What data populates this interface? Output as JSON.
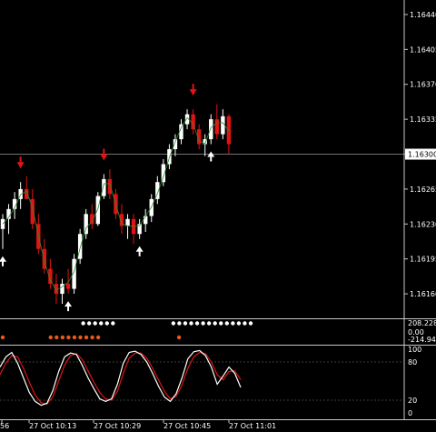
{
  "chart_data": {
    "type": "candlestick",
    "instrument_timeframe": "",
    "price_axis": {
      "ticks": [
        "1.16440",
        "1.16405",
        "1.16370",
        "1.16335",
        "1.16300",
        "1.16265",
        "1.16230",
        "1.16195",
        "1.16160"
      ],
      "current_price_label": "1.16300",
      "range": [
        1.1614,
        1.1645
      ]
    },
    "time_axis": {
      "labels": [
        "56",
        "27 Oct 10:13",
        "27 Oct 10:29",
        "27 Oct 10:45",
        "27 Oct 11:01"
      ]
    },
    "candles": [
      {
        "o": 1.16225,
        "h": 1.1624,
        "l": 1.16205,
        "c": 1.16235,
        "dir": "up"
      },
      {
        "o": 1.16235,
        "h": 1.1625,
        "l": 1.1622,
        "c": 1.16245,
        "dir": "up"
      },
      {
        "o": 1.16245,
        "h": 1.16262,
        "l": 1.16235,
        "c": 1.16255,
        "dir": "up"
      },
      {
        "o": 1.16255,
        "h": 1.16272,
        "l": 1.16245,
        "c": 1.16265,
        "dir": "up"
      },
      {
        "o": 1.16265,
        "h": 1.16278,
        "l": 1.16255,
        "c": 1.16255,
        "dir": "down"
      },
      {
        "o": 1.16255,
        "h": 1.16265,
        "l": 1.16225,
        "c": 1.1623,
        "dir": "down"
      },
      {
        "o": 1.1623,
        "h": 1.1624,
        "l": 1.162,
        "c": 1.16205,
        "dir": "down"
      },
      {
        "o": 1.16205,
        "h": 1.16215,
        "l": 1.1618,
        "c": 1.16185,
        "dir": "down"
      },
      {
        "o": 1.16185,
        "h": 1.16195,
        "l": 1.16165,
        "c": 1.1617,
        "dir": "down"
      },
      {
        "o": 1.1617,
        "h": 1.1618,
        "l": 1.1615,
        "c": 1.1616,
        "dir": "down"
      },
      {
        "o": 1.1616,
        "h": 1.16175,
        "l": 1.1615,
        "c": 1.1617,
        "dir": "up"
      },
      {
        "o": 1.1617,
        "h": 1.16185,
        "l": 1.1616,
        "c": 1.16165,
        "dir": "down"
      },
      {
        "o": 1.16165,
        "h": 1.162,
        "l": 1.1616,
        "c": 1.16195,
        "dir": "up"
      },
      {
        "o": 1.16195,
        "h": 1.16225,
        "l": 1.1619,
        "c": 1.1622,
        "dir": "up"
      },
      {
        "o": 1.1622,
        "h": 1.16245,
        "l": 1.16215,
        "c": 1.1624,
        "dir": "up"
      },
      {
        "o": 1.1624,
        "h": 1.1625,
        "l": 1.16225,
        "c": 1.1623,
        "dir": "down"
      },
      {
        "o": 1.1623,
        "h": 1.16262,
        "l": 1.16228,
        "c": 1.16258,
        "dir": "up"
      },
      {
        "o": 1.16258,
        "h": 1.1628,
        "l": 1.16255,
        "c": 1.16275,
        "dir": "up"
      },
      {
        "o": 1.16275,
        "h": 1.16285,
        "l": 1.16255,
        "c": 1.1626,
        "dir": "down"
      },
      {
        "o": 1.1626,
        "h": 1.16265,
        "l": 1.16235,
        "c": 1.1624,
        "dir": "down"
      },
      {
        "o": 1.1624,
        "h": 1.1625,
        "l": 1.1622,
        "c": 1.16228,
        "dir": "down"
      },
      {
        "o": 1.16228,
        "h": 1.1624,
        "l": 1.16215,
        "c": 1.16235,
        "dir": "up"
      },
      {
        "o": 1.16235,
        "h": 1.1624,
        "l": 1.1621,
        "c": 1.1622,
        "dir": "down"
      },
      {
        "o": 1.1622,
        "h": 1.16235,
        "l": 1.16215,
        "c": 1.1623,
        "dir": "up"
      },
      {
        "o": 1.1623,
        "h": 1.16245,
        "l": 1.16222,
        "c": 1.16238,
        "dir": "up"
      },
      {
        "o": 1.16238,
        "h": 1.1626,
        "l": 1.16232,
        "c": 1.16255,
        "dir": "up"
      },
      {
        "o": 1.16255,
        "h": 1.16278,
        "l": 1.1625,
        "c": 1.16272,
        "dir": "up"
      },
      {
        "o": 1.16272,
        "h": 1.16295,
        "l": 1.16268,
        "c": 1.1629,
        "dir": "up"
      },
      {
        "o": 1.1629,
        "h": 1.1631,
        "l": 1.16285,
        "c": 1.16305,
        "dir": "up"
      },
      {
        "o": 1.16305,
        "h": 1.1632,
        "l": 1.16298,
        "c": 1.16315,
        "dir": "up"
      },
      {
        "o": 1.16315,
        "h": 1.16335,
        "l": 1.1631,
        "c": 1.1633,
        "dir": "up"
      },
      {
        "o": 1.1633,
        "h": 1.16345,
        "l": 1.16325,
        "c": 1.1634,
        "dir": "up"
      },
      {
        "o": 1.1634,
        "h": 1.16345,
        "l": 1.1632,
        "c": 1.16325,
        "dir": "down"
      },
      {
        "o": 1.16325,
        "h": 1.1633,
        "l": 1.16305,
        "c": 1.1631,
        "dir": "down"
      },
      {
        "o": 1.1631,
        "h": 1.1632,
        "l": 1.16298,
        "c": 1.16315,
        "dir": "up"
      },
      {
        "o": 1.16315,
        "h": 1.1634,
        "l": 1.1631,
        "c": 1.16335,
        "dir": "up"
      },
      {
        "o": 1.16335,
        "h": 1.1635,
        "l": 1.16315,
        "c": 1.1632,
        "dir": "down"
      },
      {
        "o": 1.1632,
        "h": 1.16345,
        "l": 1.16315,
        "c": 1.16338,
        "dir": "up"
      },
      {
        "o": 1.16338,
        "h": 1.1634,
        "l": 1.163,
        "c": 1.1631,
        "dir": "down"
      }
    ],
    "signals": [
      {
        "candle": 0,
        "kind": "buy"
      },
      {
        "candle": 3,
        "kind": "sell"
      },
      {
        "candle": 11,
        "kind": "buy"
      },
      {
        "candle": 17,
        "kind": "sell"
      },
      {
        "candle": 23,
        "kind": "buy"
      },
      {
        "candle": 32,
        "kind": "sell"
      },
      {
        "candle": 35,
        "kind": "buy"
      }
    ],
    "histogram_panel": {
      "labels": [
        "208.228",
        "0.00",
        "-214.942"
      ],
      "white_dots": [
        12,
        13,
        14,
        15,
        16,
        17,
        27,
        28,
        29,
        30,
        31,
        32,
        33,
        34,
        35,
        36,
        37,
        38,
        39,
        40
      ],
      "red_dots": [
        0,
        5,
        6,
        7,
        8,
        9,
        10,
        11,
        12,
        13,
        22
      ]
    },
    "stochastic_panel": {
      "ticks": [
        "100",
        "80",
        "20",
        "0"
      ],
      "main": [
        72,
        88,
        95,
        78,
        55,
        32,
        18,
        12,
        15,
        35,
        65,
        88,
        94,
        92,
        75,
        55,
        38,
        22,
        18,
        22,
        45,
        78,
        95,
        97,
        92,
        80,
        62,
        42,
        25,
        18,
        30,
        55,
        85,
        96,
        98,
        90,
        72,
        45,
        58,
        72,
        62,
        40
      ],
      "signal": [
        60,
        78,
        90,
        88,
        70,
        48,
        28,
        16,
        14,
        25,
        50,
        75,
        90,
        93,
        84,
        66,
        48,
        32,
        22,
        20,
        34,
        62,
        86,
        94,
        94,
        86,
        70,
        52,
        34,
        22,
        26,
        44,
        70,
        88,
        95,
        93,
        80,
        60,
        52,
        65,
        66,
        52
      ]
    }
  }
}
